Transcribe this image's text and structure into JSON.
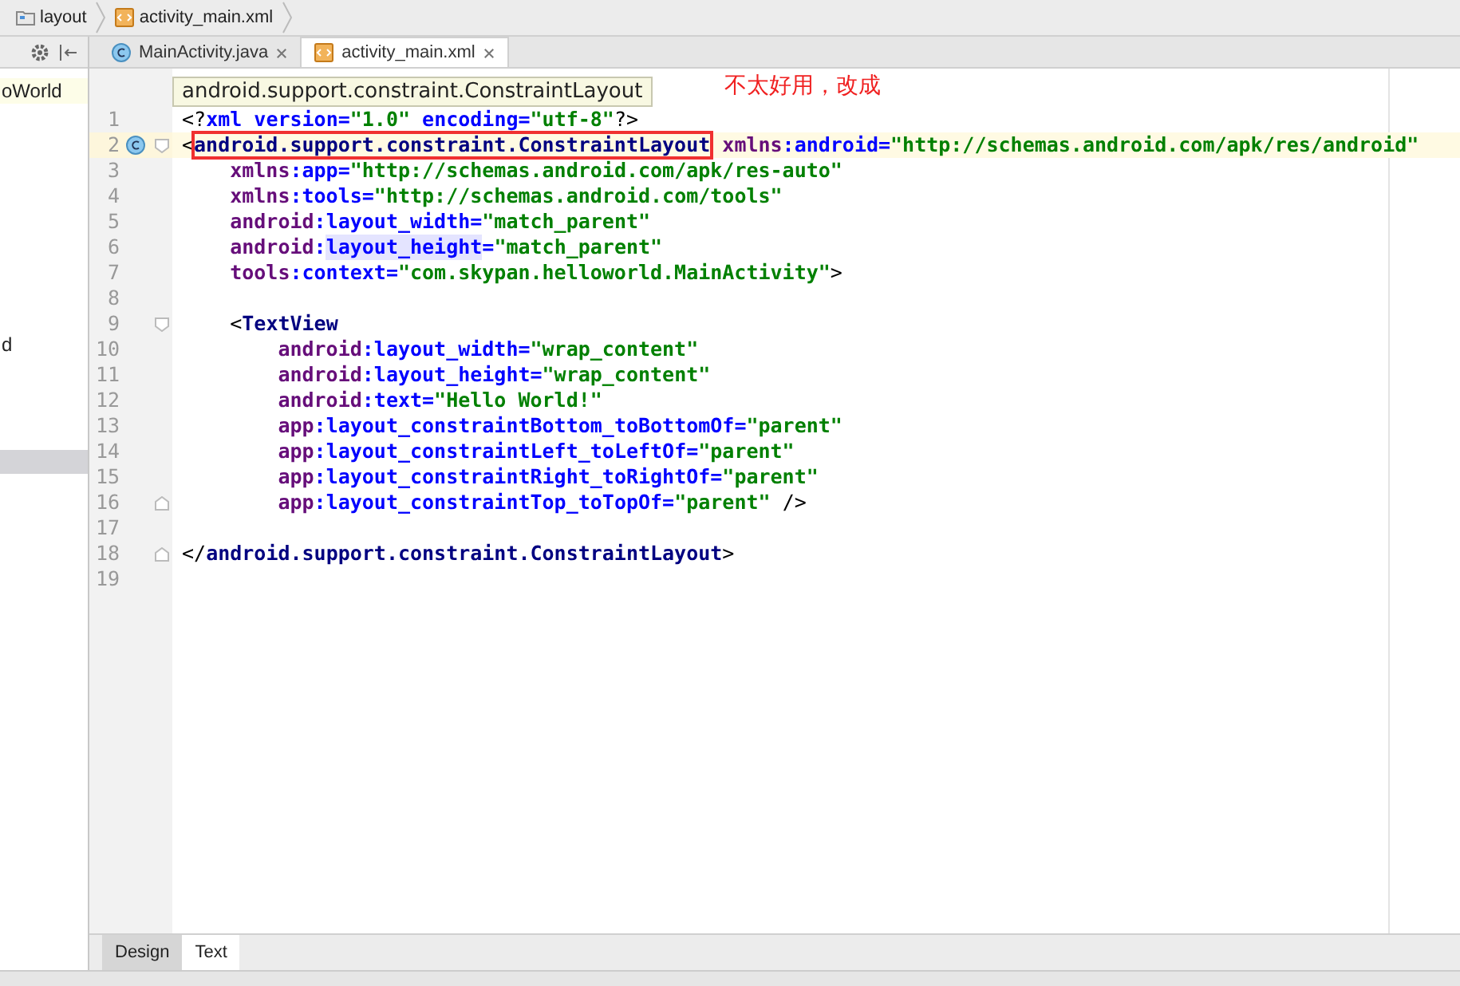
{
  "breadcrumbs": [
    {
      "label": "layout",
      "kind": "folder"
    },
    {
      "label": "activity_main.xml",
      "kind": "xml"
    }
  ],
  "project_panel": {
    "items": [
      {
        "label": "oWorld",
        "selected": false
      },
      {
        "label": "d",
        "selected": false
      },
      {
        "selected": true
      }
    ]
  },
  "editor_tabs": [
    {
      "label": "MainActivity.java",
      "kind": "class",
      "selected": false
    },
    {
      "label": "activity_main.xml",
      "kind": "xml",
      "selected": true
    }
  ],
  "tooltip": "android.support.constraint.ConstraintLayout",
  "annotation": "不太好用，改成",
  "lines": [
    {
      "number": "1",
      "current": false,
      "tokens": [
        {
          "text": "<?",
          "kind": "punct"
        },
        {
          "text": "xml version=",
          "kind": "attr"
        },
        {
          "text": "\"1.0\"",
          "kind": "value"
        },
        {
          "text": " encoding=",
          "kind": "attr"
        },
        {
          "text": "\"utf-8\"",
          "kind": "value"
        },
        {
          "text": "?>",
          "kind": "punct"
        }
      ]
    },
    {
      "number": "2",
      "current": true,
      "gutter_icon": true,
      "fold_start": true,
      "tokens": [
        {
          "text": "<",
          "kind": "punct"
        },
        {
          "text": "android.support.constraint.ConstraintLayout",
          "kind": "tag",
          "boxed": true
        },
        {
          "text": " xmlns",
          "kind": "ns"
        },
        {
          "text": ":android=",
          "kind": "attr"
        },
        {
          "text": "\"http://schemas.android.com/apk/res/android\"",
          "kind": "value"
        }
      ]
    },
    {
      "number": "3",
      "current": false,
      "tokens": [
        {
          "text": "    xmlns",
          "kind": "ns"
        },
        {
          "text": ":app=",
          "kind": "attr"
        },
        {
          "text": "\"http://schemas.android.com/apk/res-auto\"",
          "kind": "value"
        }
      ]
    },
    {
      "number": "4",
      "current": false,
      "tokens": [
        {
          "text": "    xmlns",
          "kind": "ns"
        },
        {
          "text": ":tools=",
          "kind": "attr"
        },
        {
          "text": "\"http://schemas.android.com/tools\"",
          "kind": "value"
        }
      ]
    },
    {
      "number": "5",
      "current": false,
      "tokens": [
        {
          "text": "    android",
          "kind": "ns"
        },
        {
          "text": ":layout_width=",
          "kind": "attr"
        },
        {
          "text": "\"match_parent\"",
          "kind": "value"
        }
      ]
    },
    {
      "number": "6",
      "current": false,
      "tokens": [
        {
          "text": "    android",
          "kind": "ns"
        },
        {
          "text": ":",
          "kind": "attr"
        },
        {
          "text": "layout_height",
          "kind": "attr",
          "highlighted": true
        },
        {
          "text": "=",
          "kind": "attr"
        },
        {
          "text": "\"match_parent\"",
          "kind": "value"
        }
      ]
    },
    {
      "number": "7",
      "current": false,
      "tokens": [
        {
          "text": "    tools",
          "kind": "ns"
        },
        {
          "text": ":context=",
          "kind": "attr"
        },
        {
          "text": "\"com.skypan.helloworld.MainActivity\"",
          "kind": "value"
        },
        {
          "text": ">",
          "kind": "punct"
        }
      ]
    },
    {
      "number": "8",
      "current": false
    },
    {
      "number": "9",
      "current": false,
      "fold_start": true,
      "tokens": [
        {
          "text": "    <",
          "kind": "punct"
        },
        {
          "text": "TextView",
          "kind": "tag"
        }
      ]
    },
    {
      "number": "10",
      "current": false,
      "tokens": [
        {
          "text": "        android",
          "kind": "ns"
        },
        {
          "text": ":layout_width=",
          "kind": "attr"
        },
        {
          "text": "\"wrap_content\"",
          "kind": "value"
        }
      ]
    },
    {
      "number": "11",
      "current": false,
      "tokens": [
        {
          "text": "        android",
          "kind": "ns"
        },
        {
          "text": ":layout_height=",
          "kind": "attr"
        },
        {
          "text": "\"wrap_content\"",
          "kind": "value"
        }
      ]
    },
    {
      "number": "12",
      "current": false,
      "tokens": [
        {
          "text": "        android",
          "kind": "ns"
        },
        {
          "text": ":text=",
          "kind": "attr"
        },
        {
          "text": "\"Hello World!\"",
          "kind": "value"
        }
      ]
    },
    {
      "number": "13",
      "current": false,
      "tokens": [
        {
          "text": "        app",
          "kind": "ns"
        },
        {
          "text": ":layout_constraintBottom_toBottomOf=",
          "kind": "attr"
        },
        {
          "text": "\"parent\"",
          "kind": "value"
        }
      ]
    },
    {
      "number": "14",
      "current": false,
      "tokens": [
        {
          "text": "        app",
          "kind": "ns"
        },
        {
          "text": ":layout_constraintLeft_toLeftOf=",
          "kind": "attr"
        },
        {
          "text": "\"parent\"",
          "kind": "value"
        }
      ]
    },
    {
      "number": "15",
      "current": false,
      "tokens": [
        {
          "text": "        app",
          "kind": "ns"
        },
        {
          "text": ":layout_constraintRight_toRightOf=",
          "kind": "attr"
        },
        {
          "text": "\"parent\"",
          "kind": "value"
        }
      ]
    },
    {
      "number": "16",
      "current": false,
      "fold_end": true,
      "tokens": [
        {
          "text": "        app",
          "kind": "ns"
        },
        {
          "text": ":layout_constraintTop_toTopOf=",
          "kind": "attr"
        },
        {
          "text": "\"parent\"",
          "kind": "value"
        },
        {
          "text": " />",
          "kind": "punct"
        }
      ]
    },
    {
      "number": "17",
      "current": false
    },
    {
      "number": "18",
      "current": false,
      "fold_end": true,
      "tokens": [
        {
          "text": "</",
          "kind": "punct"
        },
        {
          "text": "android.support.constraint.ConstraintLayout",
          "kind": "tag"
        },
        {
          "text": ">",
          "kind": "punct"
        }
      ]
    },
    {
      "number": "19",
      "current": false
    }
  ],
  "bottom_tabs": [
    {
      "label": "Design",
      "selected": false
    },
    {
      "label": "Text",
      "selected": true
    }
  ]
}
